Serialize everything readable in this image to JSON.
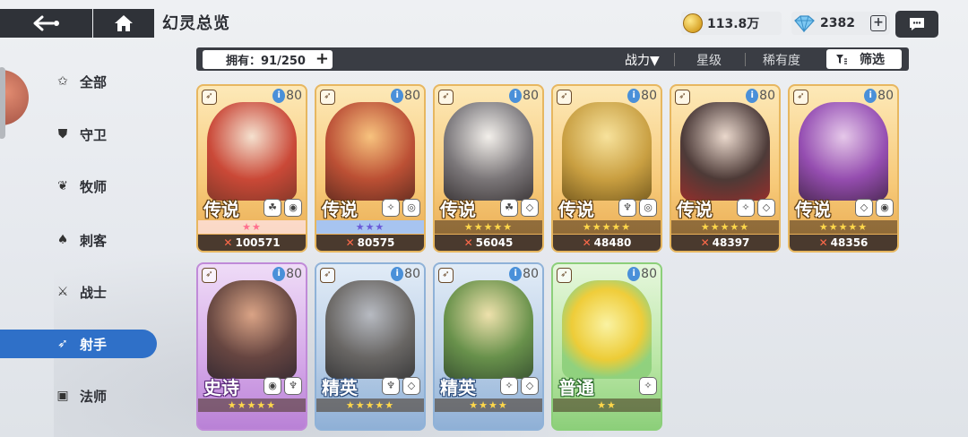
{
  "header": {
    "title": "幻灵总览",
    "back_icon": "back-arrow-icon",
    "home_icon": "home-icon"
  },
  "currency": {
    "gold": "113.8万",
    "gems": "2382"
  },
  "filterbar": {
    "owned": "拥有：91/250",
    "sort_power": "战力▼",
    "sort_star": "星级",
    "sort_rarity": "稀有度",
    "filter": "筛选"
  },
  "sidebar": {
    "items": [
      {
        "label": "全部",
        "icon": "star-outline-icon"
      },
      {
        "label": "守卫",
        "icon": "shield-icon"
      },
      {
        "label": "牧师",
        "icon": "wings-icon"
      },
      {
        "label": "刺客",
        "icon": "dagger-icon"
      },
      {
        "label": "战士",
        "icon": "sword-icon"
      },
      {
        "label": "射手",
        "icon": "bow-icon"
      },
      {
        "label": "法师",
        "icon": "book-icon"
      }
    ],
    "active_index": 5
  },
  "cards": [
    {
      "level": "80",
      "rarity": "传说",
      "stars": "★★",
      "star_style": "pink",
      "power": "100571"
    },
    {
      "level": "80",
      "rarity": "传说",
      "stars": "★★★",
      "star_style": "blue",
      "power": "80575"
    },
    {
      "level": "80",
      "rarity": "传说",
      "stars": "★★★★★",
      "star_style": "gold",
      "power": "56045"
    },
    {
      "level": "80",
      "rarity": "传说",
      "stars": "★★★★★",
      "star_style": "gold",
      "power": "48480"
    },
    {
      "level": "80",
      "rarity": "传说",
      "stars": "★★★★★",
      "star_style": "gold",
      "power": "48397"
    },
    {
      "level": "80",
      "rarity": "传说",
      "stars": "★★★★★",
      "star_style": "gold",
      "power": "48356"
    },
    {
      "level": "80",
      "rarity": "史诗",
      "stars": "★★★★★",
      "star_style": "gold",
      "power": ""
    },
    {
      "level": "80",
      "rarity": "精英",
      "stars": "★★★★★",
      "star_style": "gold",
      "power": ""
    },
    {
      "level": "80",
      "rarity": "精英",
      "stars": "★★★★",
      "star_style": "gold",
      "power": ""
    },
    {
      "level": "80",
      "rarity": "普通",
      "stars": "★★",
      "star_style": "gold",
      "power": ""
    }
  ],
  "colors": {
    "active": "#2f70c8",
    "dark_bar": "#3a3d44",
    "legendary": "#f7c978"
  }
}
